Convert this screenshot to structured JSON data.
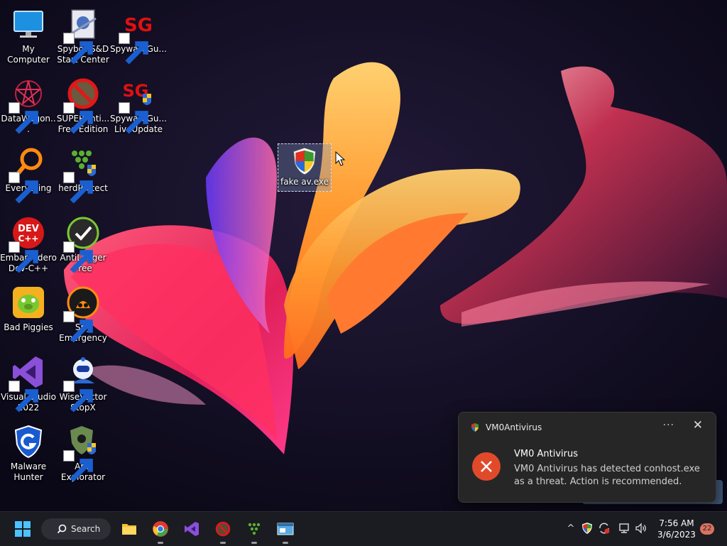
{
  "desktop": {
    "icons": [
      {
        "label": "My Computer"
      },
      {
        "label": "Spybot-S&D Start Center"
      },
      {
        "label": "SpywareGu..."
      },
      {
        "label": "DataWagon..."
      },
      {
        "label": "SUPERAnti... Free Edition"
      },
      {
        "label": "SpywareGu... LiveUpdate"
      },
      {
        "label": "Everything"
      },
      {
        "label": "herdProtect"
      },
      {
        "label": "Embarcadero Dev-C++"
      },
      {
        "label": "AntiLogger Free"
      },
      {
        "label": "Bad Piggies"
      },
      {
        "label": "Spy Emergency"
      },
      {
        "label": "Visual Studio 2022"
      },
      {
        "label": "WiseVector StopX"
      },
      {
        "label": "Malware Hunter"
      },
      {
        "label": "Anti Explorator"
      },
      {
        "label": "fake av.exe"
      }
    ],
    "logo_text": {
      "sg": "SG",
      "dev": "DEV",
      "cpp": "C++"
    }
  },
  "toast": {
    "app_name": "VM0Antivirus",
    "more": "···",
    "close": "✕",
    "title": "VM0 Antivirus",
    "body": "VM0 Antivirus has detected conhost.exe as a threat. Action is recommended."
  },
  "taskbar": {
    "search_label": "Search",
    "clock_time": "7:56 AM",
    "clock_date": "3/6/2023",
    "notification_count": "22",
    "tray_chevron": "^"
  },
  "colors": {
    "accent": "#e04a2a",
    "taskbar": "#1b1b22",
    "toast_bg": "#262626"
  }
}
